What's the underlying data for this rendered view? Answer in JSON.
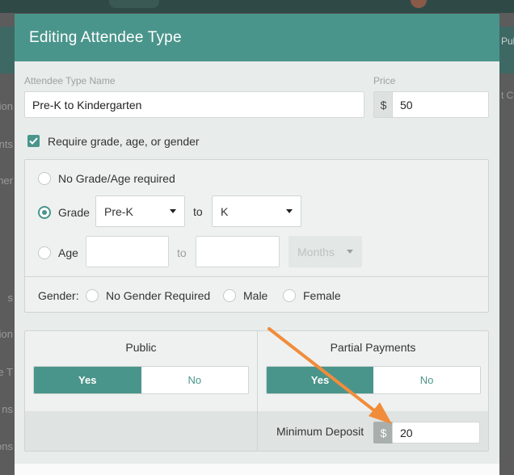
{
  "modal": {
    "title": "Editing Attendee Type",
    "name_label": "Attendee Type Name",
    "name_value": "Pre-K to Kindergarten",
    "price_label": "Price",
    "currency": "$",
    "price_value": "50",
    "require_label": "Require grade, age, or gender",
    "require_checked": true
  },
  "requirements": {
    "no_grade_label": "No Grade/Age required",
    "grade_label": "Grade",
    "grade_from": "Pre-K",
    "to_label": "to",
    "grade_to": "K",
    "age_label": "Age",
    "age_from": "",
    "age_to": "",
    "age_unit": "Months",
    "gender_label": "Gender:",
    "gender_options": [
      "No Gender Required",
      "Male",
      "Female"
    ]
  },
  "options": {
    "public_label": "Public",
    "partial_label": "Partial Payments",
    "yes_label": "Yes",
    "no_label": "No",
    "public_value": "Yes",
    "partial_value": "Yes",
    "min_deposit_label": "Minimum Deposit",
    "min_deposit_currency": "$",
    "min_deposit_value": "20"
  },
  "background": {
    "left_fragments": [
      "ation",
      "nts",
      "ner",
      "s",
      "ation",
      "ee T",
      "ns",
      "ons"
    ],
    "right_fragments": [
      "Pub",
      "t Ca"
    ]
  },
  "colors": {
    "accent": "#4a958b",
    "annotation_arrow": "#f18c3a"
  },
  "icons": {
    "check": "check-icon",
    "caret": "chevron-down-icon",
    "annotation": "arrow-annotation-icon"
  }
}
